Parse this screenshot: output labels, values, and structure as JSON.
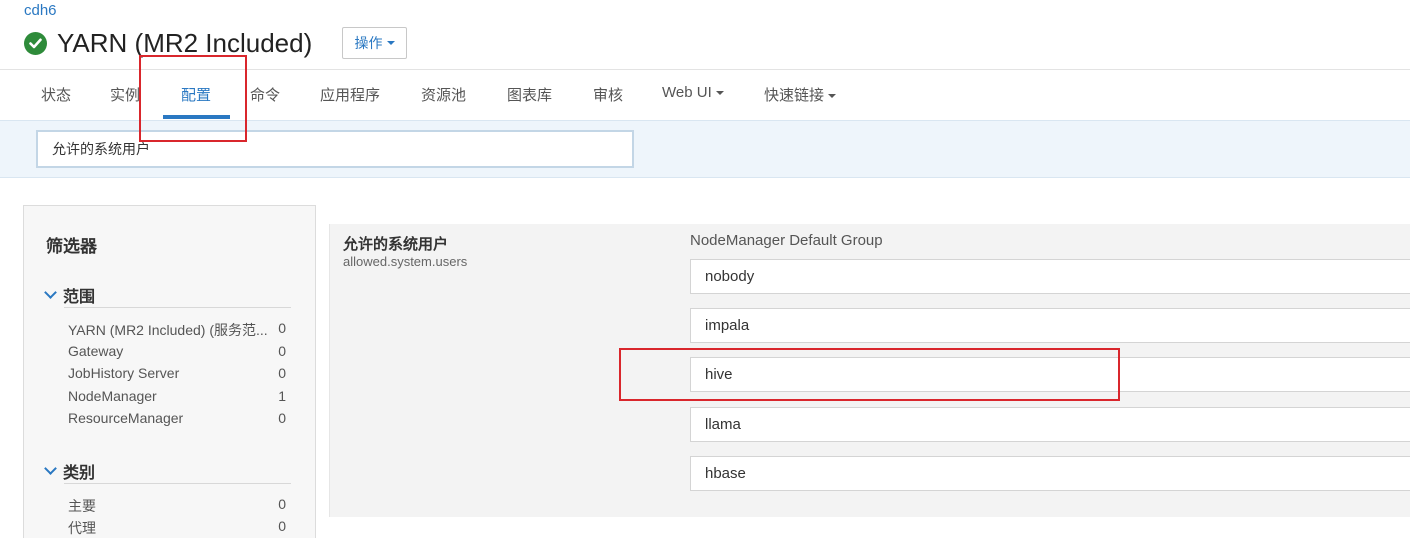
{
  "breadcrumb": "cdh6",
  "header": {
    "title": "YARN (MR2 Included)",
    "status_icon": "check-circle-icon",
    "action_label": "操作"
  },
  "tabs": [
    {
      "label": "状态"
    },
    {
      "label": "实例"
    },
    {
      "label": "配置",
      "active": true
    },
    {
      "label": "命令"
    },
    {
      "label": "应用程序"
    },
    {
      "label": "资源池"
    },
    {
      "label": "图表库"
    },
    {
      "label": "审核"
    },
    {
      "label": "Web UI",
      "dropdown": true
    },
    {
      "label": "快速链接",
      "dropdown": true
    }
  ],
  "search": {
    "value": "允许的系统用户"
  },
  "filters": {
    "title": "筛选器",
    "scope": {
      "heading": "范围",
      "items": [
        {
          "name": "YARN (MR2 Included) (服务范...",
          "count": "0"
        },
        {
          "name": "Gateway",
          "count": "0"
        },
        {
          "name": "JobHistory Server",
          "count": "0"
        },
        {
          "name": "NodeManager",
          "count": "1"
        },
        {
          "name": "ResourceManager",
          "count": "0"
        }
      ]
    },
    "category": {
      "heading": "类别",
      "items": [
        {
          "name": "主要",
          "count": "0"
        },
        {
          "name": "代理",
          "count": "0"
        }
      ]
    }
  },
  "config": {
    "property_label": "允许的系统用户",
    "property_key": "allowed.system.users",
    "group": "NodeManager Default Group",
    "values": [
      "nobody",
      "impala",
      "hive",
      "llama",
      "hbase"
    ]
  },
  "colors": {
    "accent": "#2a78c2",
    "success": "#2e8b3a",
    "highlight": "#d9262c"
  }
}
